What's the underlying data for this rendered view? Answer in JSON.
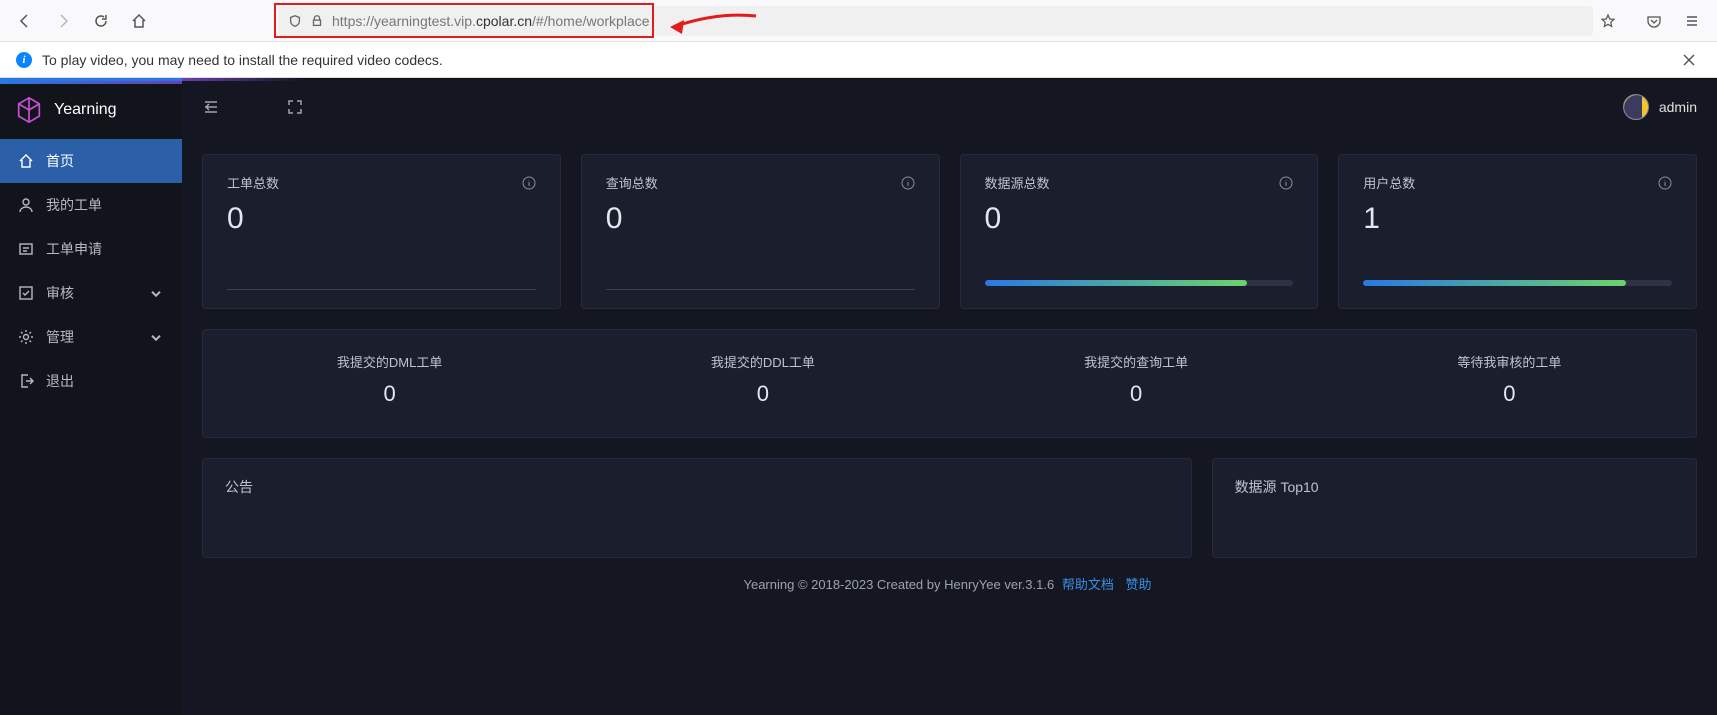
{
  "browser": {
    "url_prefix": "https://yearningtest.vip.",
    "url_bold": "cpolar.cn",
    "url_suffix": "/#/home/workplace",
    "info_message": "To play video, you may need to install the required video codecs."
  },
  "app": {
    "brand": "Yearning",
    "username": "admin"
  },
  "sidebar": {
    "items": [
      {
        "label": "首页",
        "icon": "home"
      },
      {
        "label": "我的工单",
        "icon": "user"
      },
      {
        "label": "工单申请",
        "icon": "ticket"
      },
      {
        "label": "审核",
        "icon": "check",
        "expandable": true
      },
      {
        "label": "管理",
        "icon": "gear",
        "expandable": true
      },
      {
        "label": "退出",
        "icon": "exit"
      }
    ]
  },
  "stats": [
    {
      "title": "工单总数",
      "value": "0",
      "has_bar": false
    },
    {
      "title": "查询总数",
      "value": "0",
      "has_bar": false
    },
    {
      "title": "数据源总数",
      "value": "0",
      "has_bar": true
    },
    {
      "title": "用户总数",
      "value": "1",
      "has_bar": true
    }
  ],
  "substats": [
    {
      "label": "我提交的DML工单",
      "value": "0"
    },
    {
      "label": "我提交的DDL工单",
      "value": "0"
    },
    {
      "label": "我提交的查询工单",
      "value": "0"
    },
    {
      "label": "等待我审核的工单",
      "value": "0"
    }
  ],
  "panels": {
    "announce": "公告",
    "top10": "数据源 Top10"
  },
  "footer": {
    "text": "Yearning © 2018-2023 Created by HenryYee ver.3.1.6",
    "link1": "帮助文档",
    "link2": "赞助"
  }
}
